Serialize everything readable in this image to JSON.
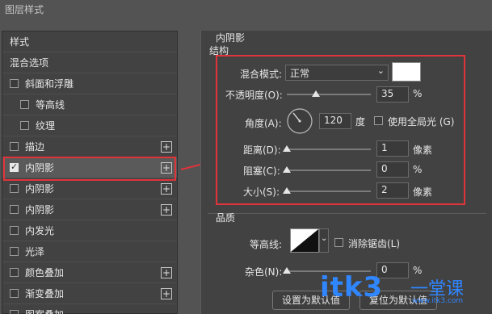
{
  "window": {
    "title": "图层样式"
  },
  "sidebar": {
    "items": [
      {
        "label": "样式",
        "checkbox": false,
        "plus": false,
        "checked": false
      },
      {
        "label": "混合选项",
        "checkbox": false,
        "plus": false,
        "checked": false
      },
      {
        "label": "斜面和浮雕",
        "checkbox": true,
        "plus": false,
        "checked": false
      },
      {
        "label": "等高线",
        "checkbox": true,
        "plus": false,
        "checked": false
      },
      {
        "label": "纹理",
        "checkbox": true,
        "plus": false,
        "checked": false
      },
      {
        "label": "描边",
        "checkbox": true,
        "plus": true,
        "checked": false
      },
      {
        "label": "内阴影",
        "checkbox": true,
        "plus": true,
        "checked": true
      },
      {
        "label": "内阴影",
        "checkbox": true,
        "plus": true,
        "checked": false
      },
      {
        "label": "内阴影",
        "checkbox": true,
        "plus": true,
        "checked": false
      },
      {
        "label": "内发光",
        "checkbox": true,
        "plus": false,
        "checked": false
      },
      {
        "label": "光泽",
        "checkbox": true,
        "plus": false,
        "checked": false
      },
      {
        "label": "颜色叠加",
        "checkbox": true,
        "plus": true,
        "checked": false
      },
      {
        "label": "渐变叠加",
        "checkbox": true,
        "plus": true,
        "checked": false
      },
      {
        "label": "图案叠加",
        "checkbox": true,
        "plus": false,
        "checked": false
      }
    ]
  },
  "panel": {
    "section_title": "内阴影",
    "structure_title": "结构",
    "blend_mode_label": "混合模式:",
    "blend_mode_value": "正常",
    "opacity_label": "不透明度(O):",
    "opacity_value": "35",
    "opacity_unit": "%",
    "opacity_level": 35,
    "angle_label": "角度(A):",
    "angle_value": "120",
    "angle_unit": "度",
    "global_light_label": "使用全局光 (G)",
    "distance_label": "距离(D):",
    "distance_value": "1",
    "distance_unit": "像素",
    "distance_level": 0,
    "choke_label": "阻塞(C):",
    "choke_value": "0",
    "choke_unit": "%",
    "choke_level": 0,
    "size_label": "大小(S):",
    "size_value": "2",
    "size_unit": "像素",
    "size_level": 0,
    "quality_title": "品质",
    "contour_label": "等高线:",
    "antialias_label": "消除锯齿(L)",
    "noise_label": "杂色(N):",
    "noise_value": "0",
    "noise_unit": "%",
    "noise_level": 0,
    "set_default_button": "设置为默认值",
    "reset_default_button": "复位为默认值",
    "shadow_color": "#ffffff"
  },
  "watermark": {
    "text": "itk3",
    "cn": "一堂课",
    "url": "www.itk3.com"
  },
  "colors": {
    "accent_red": "#e0333a",
    "watermark_blue": "#2f86ff"
  }
}
